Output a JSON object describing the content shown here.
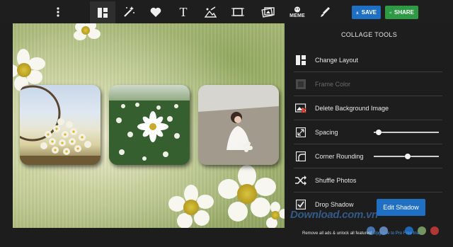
{
  "toolbar": {
    "items": [
      {
        "icon": "more-vertical-icon"
      },
      {
        "icon": "layout-icon",
        "active": true
      },
      {
        "icon": "magic-wand-icon"
      },
      {
        "icon": "heart-icon"
      },
      {
        "icon": "text-icon",
        "glyph": "T"
      },
      {
        "icon": "image-edit-icon"
      },
      {
        "icon": "crop-frame-icon"
      },
      {
        "icon": "photos-icon"
      },
      {
        "icon": "meme-icon",
        "label": "MEME"
      },
      {
        "icon": "brush-icon"
      }
    ],
    "save_label": "SAVE",
    "share_label": "SHARE"
  },
  "panel": {
    "title": "COLLAGE TOOLS",
    "tools": [
      {
        "label": "Change Layout",
        "icon": "layout-icon"
      },
      {
        "label": "Frame Color",
        "icon": "frame-color-icon",
        "disabled": true
      },
      {
        "label": "Delete Background Image",
        "icon": "delete-image-icon"
      },
      {
        "label": "Spacing",
        "icon": "spacing-icon",
        "slider": 0.07
      },
      {
        "label": "Corner Rounding",
        "icon": "corner-rounding-icon",
        "slider": 0.52
      },
      {
        "label": "Shuffle Photos",
        "icon": "shuffle-icon"
      },
      {
        "label": "Drop Shadow",
        "icon": "checkbox-icon",
        "checked": true
      }
    ],
    "edit_shadow_label": "Edit Shadow",
    "promo_text": "Remove all ads & unlock all features!",
    "promo_link_a": "Upgrade to",
    "promo_link_b": "Pro",
    "promo_link_c": "Free trial",
    "watermark": "Download.com.vn"
  },
  "colors": {
    "accent_blue": "#1f6fc3",
    "share_green": "#2e9a44",
    "panel_bg": "#1d1d1d"
  }
}
